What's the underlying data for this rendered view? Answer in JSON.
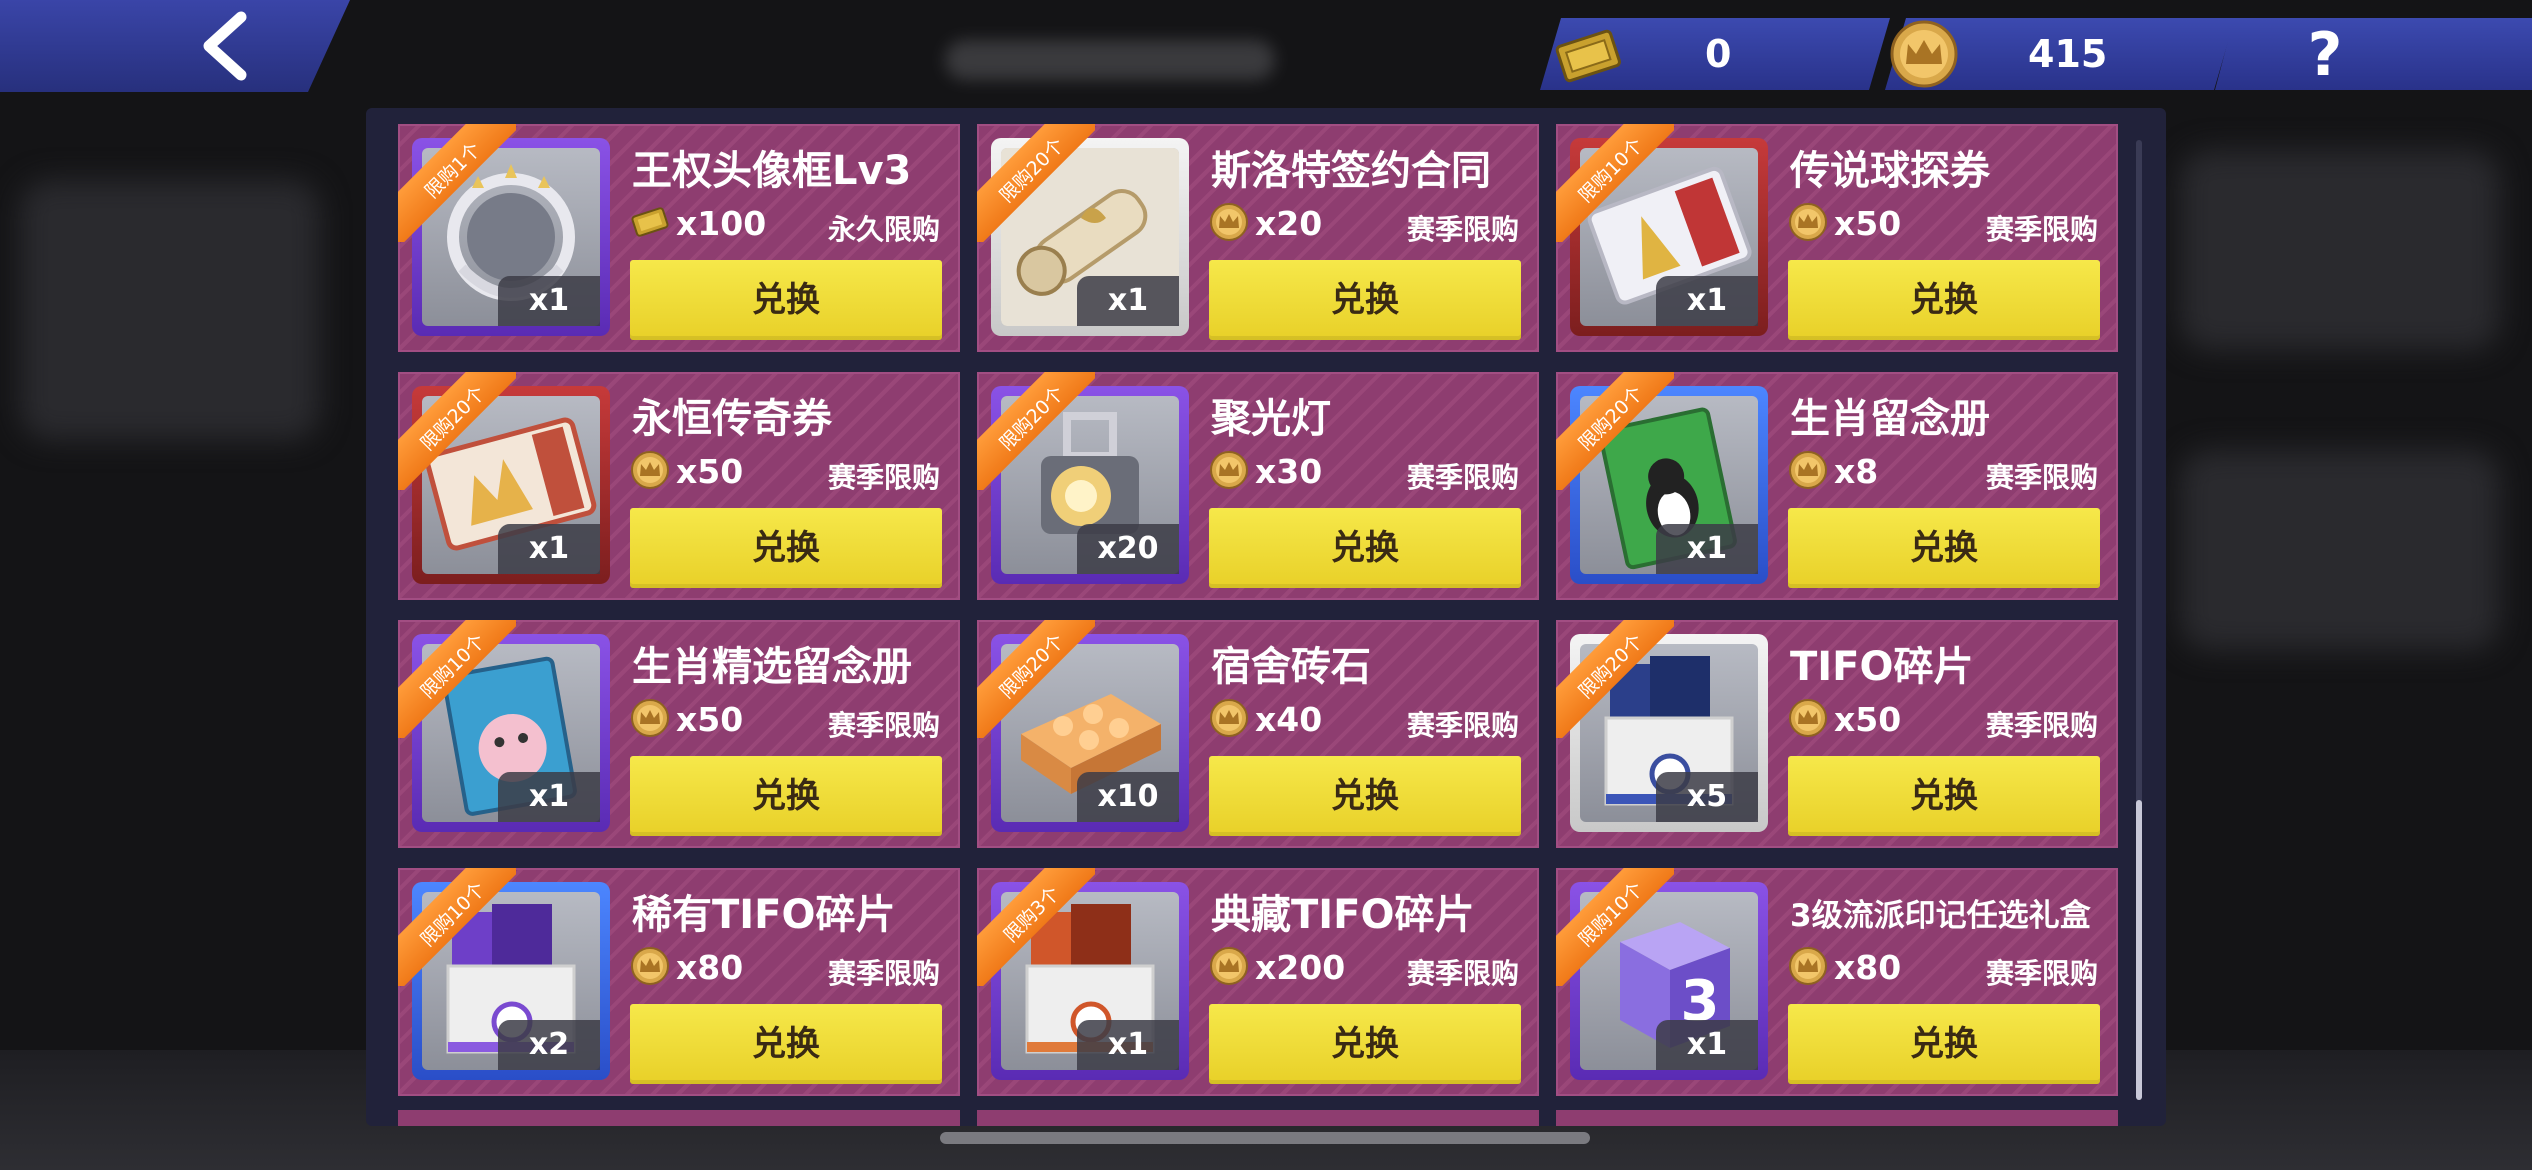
{
  "header": {
    "back_label": "<",
    "help_label": "?"
  },
  "currencies": [
    {
      "icon": "ticket-icon",
      "value": "0"
    },
    {
      "icon": "crown-coin-icon",
      "value": "415"
    }
  ],
  "redeem_label": "兑换",
  "items": [
    {
      "ribbon": "限购1个",
      "name": "王权头像框Lv3",
      "price_icon": "ticket-icon",
      "price": "x100",
      "limit": "永久限购",
      "qty": "x1",
      "frame": "purple",
      "art": "frame"
    },
    {
      "ribbon": "限购20个",
      "name": "斯洛特签约合同",
      "price_icon": "crown-coin-icon",
      "price": "x20",
      "limit": "赛季限购",
      "qty": "x1",
      "frame": "white",
      "art": "scroll"
    },
    {
      "ribbon": "限购10个",
      "name": "传说球探券",
      "price_icon": "crown-coin-icon",
      "price": "x50",
      "limit": "赛季限购",
      "qty": "x1",
      "frame": "red",
      "art": "ticket-legend"
    },
    {
      "ribbon": "限购20个",
      "name": "永恒传奇券",
      "price_icon": "crown-coin-icon",
      "price": "x50",
      "limit": "赛季限购",
      "qty": "x1",
      "frame": "red",
      "art": "ticket-eternity"
    },
    {
      "ribbon": "限购20个",
      "name": "聚光灯",
      "price_icon": "crown-coin-icon",
      "price": "x30",
      "limit": "赛季限购",
      "qty": "x20",
      "frame": "purple",
      "art": "spotlight"
    },
    {
      "ribbon": "限购20个",
      "name": "生肖留念册",
      "price_icon": "crown-coin-icon",
      "price": "x8",
      "limit": "赛季限购",
      "qty": "x1",
      "frame": "blue",
      "art": "book-green"
    },
    {
      "ribbon": "限购10个",
      "name": "生肖精选留念册",
      "price_icon": "crown-coin-icon",
      "price": "x50",
      "limit": "赛季限购",
      "qty": "x1",
      "frame": "purple",
      "art": "book-blue"
    },
    {
      "ribbon": "限购20个",
      "name": "宿舍砖石",
      "price_icon": "crown-coin-icon",
      "price": "x40",
      "limit": "赛季限购",
      "qty": "x10",
      "frame": "purple",
      "art": "brick"
    },
    {
      "ribbon": "限购20个",
      "name": "TIFO碎片",
      "price_icon": "crown-coin-icon",
      "price": "x50",
      "limit": "赛季限购",
      "qty": "x5",
      "frame": "white",
      "art": "box-blue"
    },
    {
      "ribbon": "限购10个",
      "name": "稀有TIFO碎片",
      "price_icon": "crown-coin-icon",
      "price": "x80",
      "limit": "赛季限购",
      "qty": "x2",
      "frame": "blue",
      "art": "box-purple"
    },
    {
      "ribbon": "限购3个",
      "name": "典藏TIFO碎片",
      "price_icon": "crown-coin-icon",
      "price": "x200",
      "limit": "赛季限购",
      "qty": "x1",
      "frame": "purple",
      "art": "box-orange"
    },
    {
      "ribbon": "限购10个",
      "name": "3级流派印记任选礼盒",
      "price_icon": "crown-coin-icon",
      "price": "x80",
      "limit": "赛季限购",
      "qty": "x1",
      "frame": "purple",
      "art": "cube-3"
    }
  ]
}
